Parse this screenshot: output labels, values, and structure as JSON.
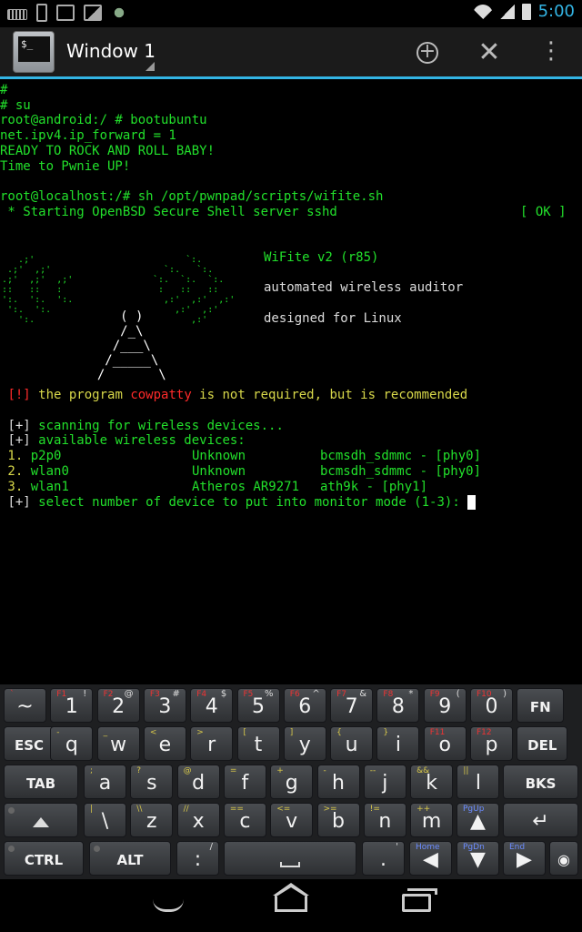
{
  "status_bar": {
    "time": "5:00"
  },
  "action_bar": {
    "app_icon_text": "$_",
    "window_title": "Window 1",
    "new_window_symbol": "+",
    "close_symbol": "✕",
    "menu_symbol": "⋮"
  },
  "terminal": {
    "lines": [
      "#",
      "# su",
      "root@android:/ # bootubuntu",
      "net.ipv4.ip_forward = 1",
      "READY TO ROCK AND ROLL BABY!",
      "Time to Pwnie UP!",
      "",
      "root@localhost:/# sh /opt/pwnpad/scripts/wifite.sh"
    ],
    "sshd_msg": " * Starting OpenBSD Secure Shell server sshd",
    "sshd_status": "[ OK ]",
    "wifite_title": "WiFite v2 (r85)",
    "wifite_desc1": "automated wireless auditor",
    "wifite_desc2": "designed for Linux",
    "antenna_art": [
      "     ( )",
      "     /_\\",
      "    /___\\",
      "   /_____\\",
      "  /       \\"
    ],
    "wave_left": [
      "   .;'",
      " .;'  ,;'",
      ".;'  ,;'  ,;'",
      "::   ::   :   ",
      "':.  ':.  ':. ",
      " ':.  ':.",
      "   ':."
    ],
    "wave_right": [
      "      `:.",
      "  `:.   `:.",
      "`:.  `:.  `:.",
      " :   ::   ::",
      "  ,:'  ,:'  ,:'",
      "    ,:'  ,:'",
      "       ,:'"
    ],
    "warn_bracket": "[!]",
    "warn_text_a": " the program ",
    "warn_program": "cowpatty",
    "warn_text_b": " is not required, but is recommended",
    "scan_bracket": "[+]",
    "scan_text": " scanning for wireless devices...",
    "avail_bracket": "[+]",
    "avail_text": " available wireless devices:",
    "devices": [
      {
        "num": " 1.",
        "iface": " p2p0",
        "driver": "Unknown",
        "chipset": "bcmsdh_sdmmc - [phy0]"
      },
      {
        "num": " 2.",
        "iface": " wlan0",
        "driver": "Unknown",
        "chipset": "bcmsdh_sdmmc - [phy0]"
      },
      {
        "num": " 3.",
        "iface": " wlan1",
        "driver": "Atheros AR9271",
        "chipset": "ath9k - [phy1]"
      }
    ],
    "select_bracket": "[+]",
    "select_text": " select number of device to put into monitor mode (1-3): "
  },
  "keyboard": {
    "row1": [
      {
        "main": "~",
        "sub": "`",
        "sub_color": "r"
      },
      {
        "main": "1",
        "sub": "F1",
        "sub2": "!",
        "sub_color": "r"
      },
      {
        "main": "2",
        "sub": "F2",
        "sub2": "@",
        "sub_color": "r"
      },
      {
        "main": "3",
        "sub": "F3",
        "sub2": "#",
        "sub_color": "r"
      },
      {
        "main": "4",
        "sub": "F4",
        "sub2": "$",
        "sub_color": "r"
      },
      {
        "main": "5",
        "sub": "F5",
        "sub2": "%",
        "sub_color": "r"
      },
      {
        "main": "6",
        "sub": "F6",
        "sub2": "^",
        "sub_color": "r"
      },
      {
        "main": "7",
        "sub": "F7",
        "sub2": "&",
        "sub_color": "r"
      },
      {
        "main": "8",
        "sub": "F8",
        "sub2": "*",
        "sub_color": "r"
      },
      {
        "main": "9",
        "sub": "F9",
        "sub2": "(",
        "sub_color": "r"
      },
      {
        "main": "0",
        "sub": "F10",
        "sub2": ")",
        "sub_color": "r"
      },
      {
        "main": "FN",
        "fn": true
      }
    ],
    "row2": [
      {
        "main": "ESC",
        "fn": true
      },
      {
        "main": "q",
        "sub": "-",
        "sub_color": "y"
      },
      {
        "main": "w",
        "sub": "_",
        "sub_color": "y"
      },
      {
        "main": "e",
        "sub": "<",
        "sub_color": "y"
      },
      {
        "main": "r",
        "sub": ">",
        "sub_color": "y"
      },
      {
        "main": "t",
        "sub": "[",
        "sub_color": "y"
      },
      {
        "main": "y",
        "sub": "]",
        "sub_color": "y"
      },
      {
        "main": "u",
        "sub": "{",
        "sub_color": "y"
      },
      {
        "main": "i",
        "sub": "}",
        "sub_color": "y"
      },
      {
        "main": "o",
        "sub": "F11",
        "sub_color": "r"
      },
      {
        "main": "p",
        "sub": "F12",
        "sub_color": "r"
      },
      {
        "main": "DEL",
        "fn": true
      }
    ],
    "row3": [
      {
        "main": "TAB",
        "fn": true
      },
      {
        "main": "a",
        "sub": ";",
        "sub_color": "y"
      },
      {
        "main": "s",
        "sub": "?",
        "sub_color": "y"
      },
      {
        "main": "d",
        "sub": "@",
        "sub_color": "y"
      },
      {
        "main": "f",
        "sub": "=",
        "sub_color": "y"
      },
      {
        "main": "g",
        "sub": "+",
        "sub_color": "y"
      },
      {
        "main": "h",
        "sub": "-",
        "sub_color": "y"
      },
      {
        "main": "j",
        "sub": "--",
        "sub_color": "y"
      },
      {
        "main": "k",
        "sub": "&&",
        "sub_color": "y"
      },
      {
        "main": "l",
        "sub": "||",
        "sub_color": "y"
      },
      {
        "main": "BKS",
        "fn": true
      }
    ],
    "row4": [
      {
        "main": "\\",
        "sub": "|",
        "sub_color": "y"
      },
      {
        "main": "z",
        "sub": "\\\\",
        "sub_color": "y"
      },
      {
        "main": "x",
        "sub": "//",
        "sub_color": "y"
      },
      {
        "main": "c",
        "sub": "==",
        "sub_color": "y"
      },
      {
        "main": "v",
        "sub": "<=",
        "sub_color": "y"
      },
      {
        "main": "b",
        "sub": ">=",
        "sub_color": "y"
      },
      {
        "main": "n",
        "sub": "!=",
        "sub_color": "y"
      },
      {
        "main": "m",
        "sub": "++",
        "sub_color": "y"
      }
    ],
    "pgup": "PgUp",
    "pgdn": "PgDn",
    "home": "Home",
    "end": "End",
    "ctrl": "CTRL",
    "alt": "ALT",
    "colon": ":",
    "colon_sub": "/",
    "period": ".",
    "period_sub": "'"
  }
}
